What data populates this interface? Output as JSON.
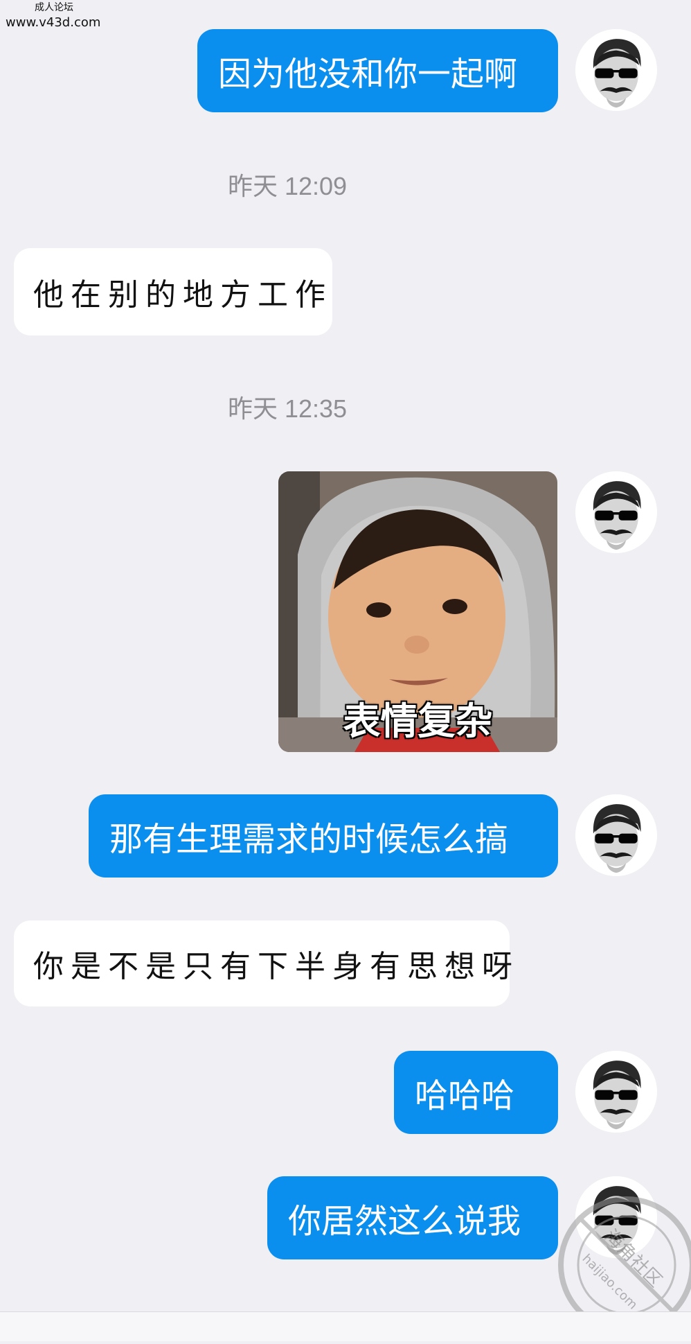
{
  "watermark": {
    "line1": "成人论坛",
    "line2": "www.v43d.com"
  },
  "timestamps": [
    "昨天 12:09",
    "昨天 12:35"
  ],
  "messages": [
    {
      "side": "sent",
      "text": "因为他没和你一起啊"
    },
    {
      "side": "received",
      "text": "他在别的地方工作"
    },
    {
      "side": "sent",
      "type": "sticker",
      "caption": "表情复杂"
    },
    {
      "side": "sent",
      "text": "那有生理需求的时候怎么搞"
    },
    {
      "side": "received",
      "text": "你是不是只有下半身有思想呀"
    },
    {
      "side": "sent",
      "text": "哈哈哈"
    },
    {
      "side": "sent",
      "text": "你居然这么说我"
    }
  ],
  "stamp": {
    "label": "海角社区",
    "domain": "haijiao.com"
  },
  "colors": {
    "background": "#efeff4",
    "sent_bubble": "#0b8fef",
    "received_bubble": "#ffffff",
    "timestamp": "#8e8e93"
  },
  "icons": {
    "avatar": "man-sunglasses-mustache-avatar"
  }
}
